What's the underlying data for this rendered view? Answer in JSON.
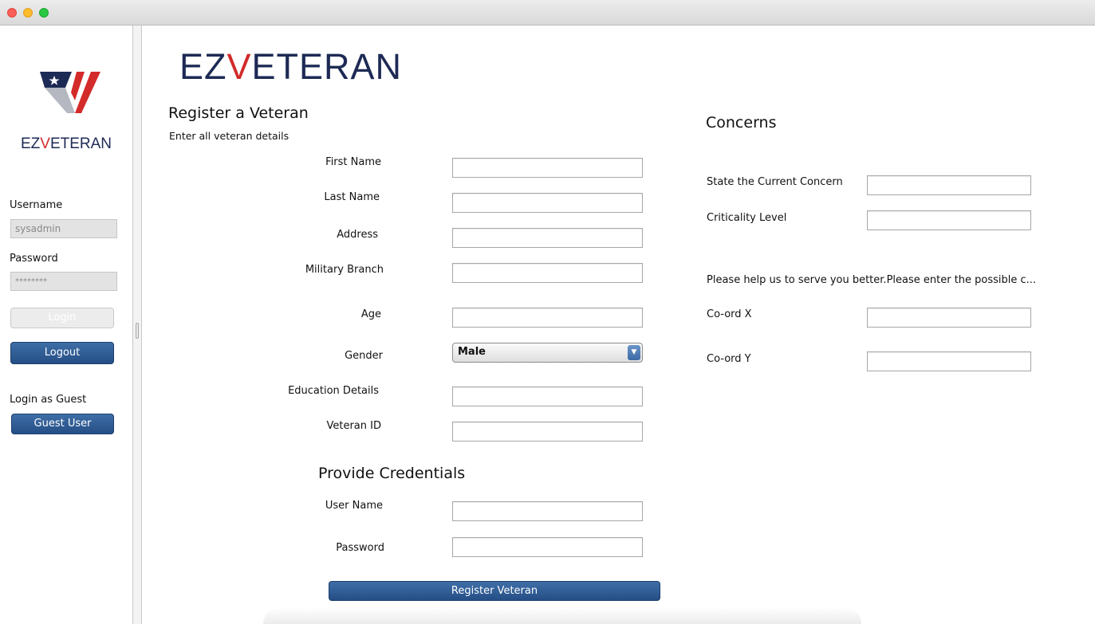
{
  "brand": {
    "name_prefix": "EZ",
    "name_v": "V",
    "name_suffix": "ETERAN"
  },
  "sidebar": {
    "username_label": "Username",
    "username_value": "sysadmin",
    "password_label": "Password",
    "password_value": "********",
    "login_label": "Login",
    "logout_label": "Logout",
    "guest_heading": "Login as Guest",
    "guest_button": "Guest User"
  },
  "register": {
    "title": "Register a Veteran",
    "subtitle": "Enter all veteran details",
    "fields": {
      "first_name": "First Name",
      "last_name": "Last Name",
      "address": "Address",
      "military_branch": "Military Branch",
      "age": "Age",
      "gender": "Gender",
      "education": "Education Details",
      "veteran_id": "Veteran ID"
    },
    "gender_selected": "Male",
    "credentials_title": "Provide Credentials",
    "user_name": "User Name",
    "password": "Password",
    "submit": "Register Veteran"
  },
  "concerns": {
    "title": "Concerns",
    "current_concern": "State the Current Concern",
    "criticality": "Criticality Level",
    "help_text": "Please help us to serve you better.Please enter the possible c...",
    "coord_x": "Co-ord X",
    "coord_y": "Co-ord Y"
  },
  "colors": {
    "brand_navy": "#1d2a55",
    "brand_red": "#d32a2a",
    "button_blue": "#2f5a92"
  }
}
